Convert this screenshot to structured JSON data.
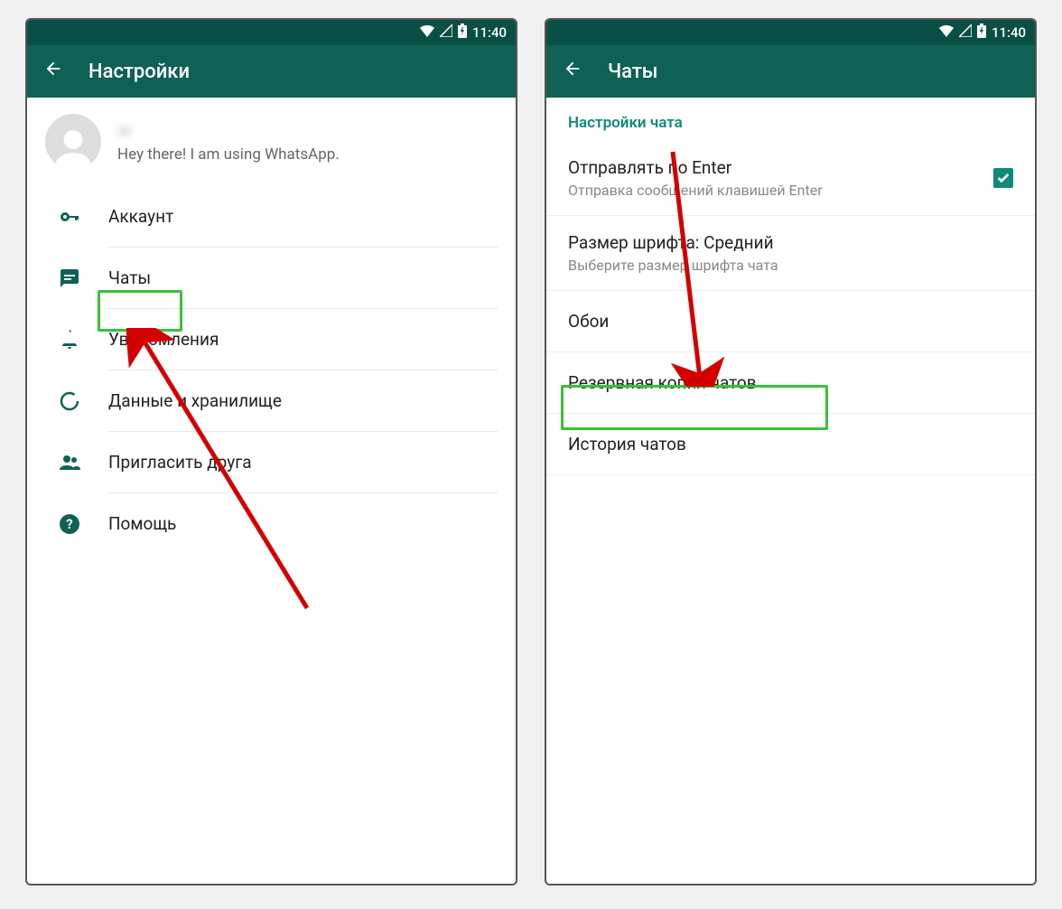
{
  "status_bar": {
    "time": "11:40"
  },
  "left": {
    "header": {
      "title": "Настройки"
    },
    "profile": {
      "name": "—",
      "status": "Hey there! I am using WhatsApp."
    },
    "menu": {
      "account": "Аккаунт",
      "chats": "Чаты",
      "notifications": "Уведомления",
      "data": "Данные и хранилище",
      "invite": "Пригласить друга",
      "help": "Помощь"
    }
  },
  "right": {
    "header": {
      "title": "Чаты"
    },
    "section_header": "Настройки чата",
    "enter_send": {
      "title": "Отправлять по Enter",
      "sub": "Отправка сообщений клавишей Enter"
    },
    "font_size": {
      "title": "Размер шрифта: Средний",
      "sub": "Выберите размер шрифта чата"
    },
    "wallpaper": "Обои",
    "backup": "Резервная копия чатов",
    "history": "История чатов"
  }
}
